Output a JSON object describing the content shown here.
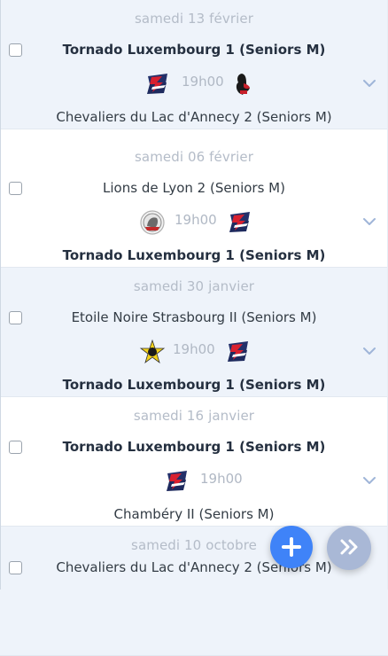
{
  "games": [
    {
      "date": "samedi 13 février",
      "home": "Tornado Luxembourg 1 (Seniors M)",
      "away": "Chevaliers du Lac d'Annecy 2 (Seniors M)",
      "time": "19h00",
      "home_bold": true,
      "home_logo": "tornado-logo",
      "away_logo": "chevaliers-logo"
    },
    {
      "date": "samedi 06 février",
      "home": "Lions de Lyon 2 (Seniors M)",
      "away": "Tornado Luxembourg 1 (Seniors M)",
      "time": "19h00",
      "home_bold": false,
      "home_logo": "lions-logo",
      "away_logo": "tornado-logo"
    },
    {
      "date": "samedi 30 janvier",
      "home": "Etoile Noire Strasbourg II (Seniors M)",
      "away": "Tornado Luxembourg 1 (Seniors M)",
      "time": "19h00",
      "home_bold": false,
      "home_logo": "etoile-noire-logo",
      "away_logo": "tornado-logo"
    },
    {
      "date": "samedi 16 janvier",
      "home": "Tornado Luxembourg 1 (Seniors M)",
      "away": "Chambéry II (Seniors M)",
      "time": "19h00",
      "home_bold": true,
      "home_logo": "tornado-logo",
      "away_logo": ""
    },
    {
      "date": "samedi 10 octobre",
      "home": "Chevaliers du Lac d'Annecy 2 (Seniors M)",
      "home_bold": false
    }
  ],
  "colors": {
    "accent": "#3f83f8",
    "secondary_fab": "#a9b8d6",
    "row_alt": "#eef3fa"
  },
  "icons": {
    "add": "plus-icon",
    "next": "double-chevron-right-icon",
    "expand": "chevron-down-icon"
  }
}
